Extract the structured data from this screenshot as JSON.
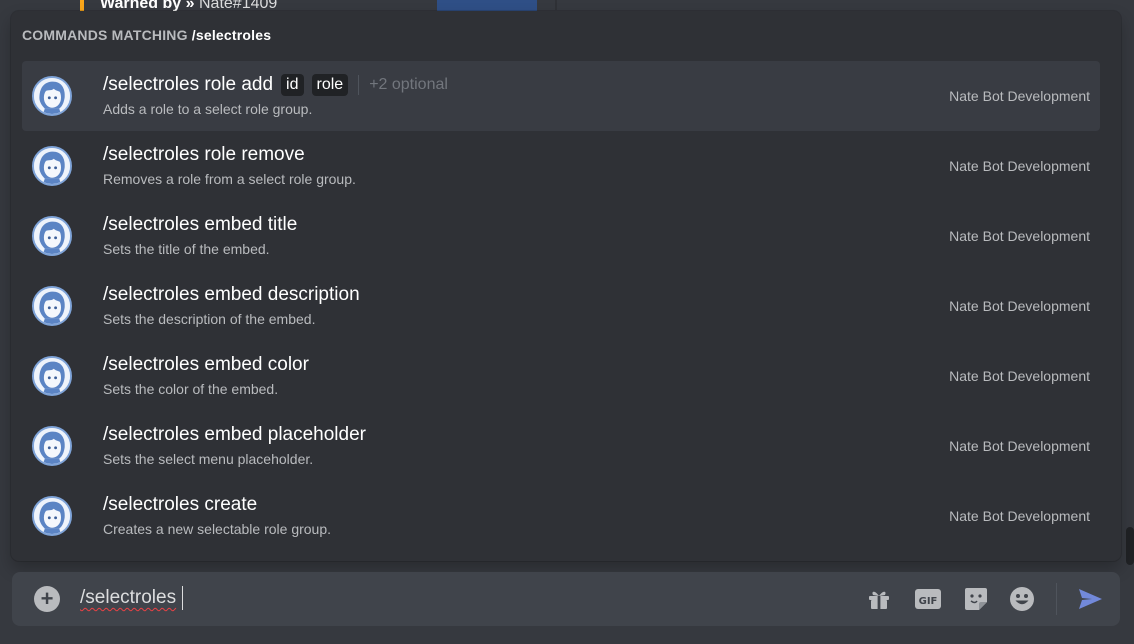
{
  "background": {
    "warned_label": "Warned by »",
    "warned_user": "Nate#1409"
  },
  "popup": {
    "header_prefix": "Commands matching",
    "header_query": "/selectroles",
    "commands": [
      {
        "name": "/selectroles role add",
        "options": [
          "id",
          "role"
        ],
        "optional_more": "+2 optional",
        "description": "Adds a role to a select role group.",
        "source": "Nate Bot Development",
        "selected": true
      },
      {
        "name": "/selectroles role remove",
        "description": "Removes a role from a select role group.",
        "source": "Nate Bot Development"
      },
      {
        "name": "/selectroles embed title",
        "description": "Sets the title of the embed.",
        "source": "Nate Bot Development"
      },
      {
        "name": "/selectroles embed description",
        "description": "Sets the description of the embed.",
        "source": "Nate Bot Development"
      },
      {
        "name": "/selectroles embed color",
        "description": "Sets the color of the embed.",
        "source": "Nate Bot Development"
      },
      {
        "name": "/selectroles embed placeholder",
        "description": "Sets the select menu placeholder.",
        "source": "Nate Bot Development"
      },
      {
        "name": "/selectroles create",
        "description": "Creates a new selectable role group.",
        "source": "Nate Bot Development"
      }
    ]
  },
  "chat_input": {
    "value": "/selectroles",
    "icons": [
      "plus-icon",
      "gift-icon",
      "gif-icon",
      "sticker-icon",
      "emoji-icon",
      "send-icon"
    ]
  },
  "colors": {
    "background": "#36393f",
    "popup": "#2f3136",
    "selected_row": "#393c43",
    "input": "#40444b",
    "send_accent": "#7289da",
    "warn_bar": "#faa61a"
  }
}
